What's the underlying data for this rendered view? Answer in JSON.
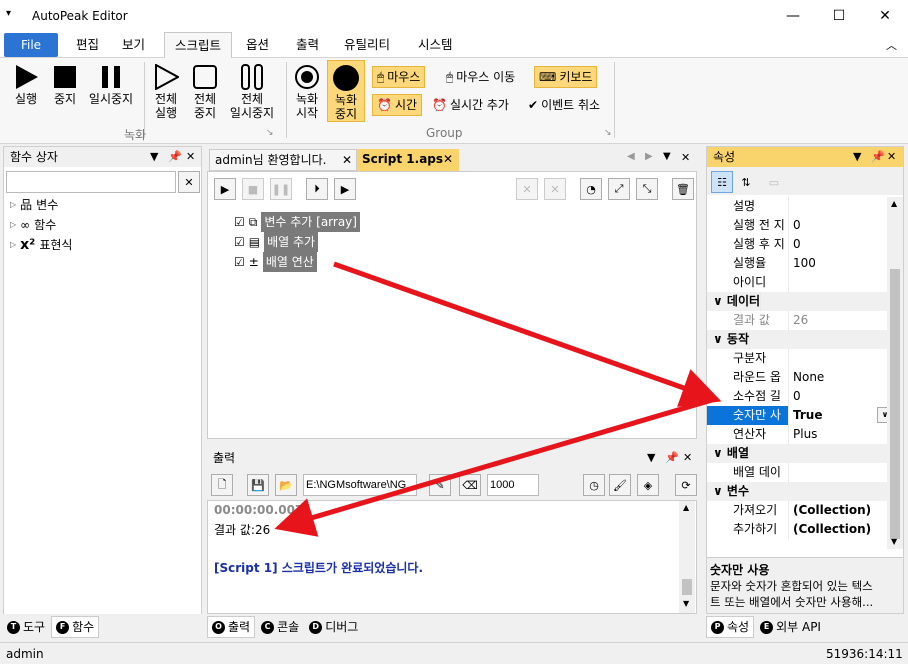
{
  "app": {
    "title": "AutoPeak Editor"
  },
  "menu": {
    "file": "File",
    "items": [
      "편집",
      "보기",
      "스크립트",
      "옵션",
      "출력",
      "유틸리티",
      "시스템"
    ]
  },
  "ribbon": {
    "run": "실행",
    "stop": "중지",
    "pause": "일시중지",
    "run_all_1": "전체",
    "run_all_2": "실행",
    "stop_all_1": "전체",
    "stop_all_2": "중지",
    "pause_all_1": "전체",
    "pause_all_2": "일시중지",
    "rec_start_1": "녹화",
    "rec_start_2": "시작",
    "rec_stop_1": "녹화",
    "rec_stop_2": "중지",
    "mouse": "마우스",
    "mouse_move": "마우스 이동",
    "keyboard": "키보드",
    "time": "시간",
    "realtime_add": "실시간 추가",
    "event_cancel": "이벤트 취소",
    "group1": "녹화",
    "group2": "Group"
  },
  "left": {
    "title": "함수 상자",
    "search_value": "",
    "items": [
      "변수",
      "함수",
      "표현식"
    ],
    "tab_tool": "도구",
    "tab_func": "함수"
  },
  "editor": {
    "tab_welcome": "admin님 환영합니다.",
    "tab_script": "Script 1.aps",
    "nodes": [
      "변수 추가 [array]",
      "배열 추가",
      "배열 연산"
    ]
  },
  "output": {
    "title": "출력",
    "path": "E:\\NGMsoftware\\NG",
    "interval": "1000",
    "time": "00:00:00.007",
    "result": "결과 값:26",
    "done": "[Script 1] 스크립트가 완료되었습니다.",
    "tab_output": "출력",
    "tab_console": "콘솔",
    "tab_debug": "디버그"
  },
  "props": {
    "title": "속성",
    "rows": [
      {
        "n": "설명",
        "v": ""
      },
      {
        "n": "실행 전 지",
        "v": "0"
      },
      {
        "n": "실행 후 지",
        "v": "0"
      },
      {
        "n": "실행율",
        "v": "100"
      },
      {
        "n": "아이디",
        "v": ""
      }
    ],
    "cat_data": "데이터",
    "data_rows": [
      {
        "n": "결과 값",
        "v": "26"
      }
    ],
    "cat_action": "동작",
    "action_rows": [
      {
        "n": "구분자",
        "v": ""
      },
      {
        "n": "라운드 옵",
        "v": "None"
      },
      {
        "n": "소수점 길",
        "v": "0"
      },
      {
        "n": "숫자만 사",
        "v": "True"
      },
      {
        "n": "연산자",
        "v": "Plus"
      }
    ],
    "cat_array": "배열",
    "array_rows": [
      {
        "n": "배열 데이",
        "v": ""
      }
    ],
    "cat_var": "변수",
    "var_rows": [
      {
        "n": "가져오기",
        "v": "(Collection)"
      },
      {
        "n": "추가하기",
        "v": "(Collection)"
      }
    ],
    "desc_title": "숫자만 사용",
    "desc_text1": "문자와 숫자가 혼합되어 있는 텍스",
    "desc_text2": "트 또는 배열에서 숫자만 사용해...",
    "tab_props": "속성",
    "tab_api": "외부 API"
  },
  "status": {
    "user": "admin",
    "time": "51936:14:11"
  },
  "colors": {
    "accent": "#2b74d4",
    "highlight": "#fdd87a",
    "arrow": "#e8141c"
  }
}
